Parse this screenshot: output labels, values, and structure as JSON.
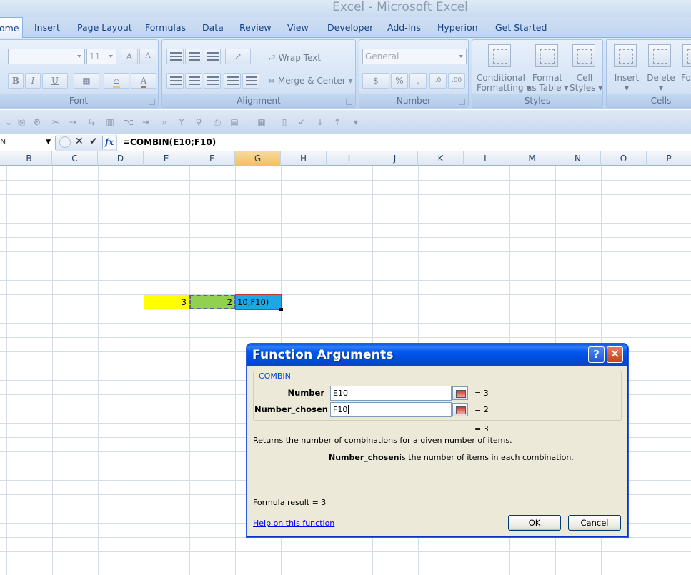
{
  "app": {
    "title": "Excel - Microsoft Excel"
  },
  "tabs": [
    {
      "label": "ome"
    },
    {
      "label": "Insert"
    },
    {
      "label": "Page Layout"
    },
    {
      "label": "Formulas"
    },
    {
      "label": "Data"
    },
    {
      "label": "Review"
    },
    {
      "label": "View"
    },
    {
      "label": "Developer"
    },
    {
      "label": "Add-Ins"
    },
    {
      "label": "Hyperion"
    },
    {
      "label": "Get Started"
    }
  ],
  "ribbon": {
    "font": {
      "label": "Font",
      "size": "11",
      "bold": "B",
      "italic": "I",
      "underline": "U"
    },
    "alignment": {
      "label": "Alignment",
      "wrap_text": "Wrap Text",
      "merge_center": "Merge & Center"
    },
    "number": {
      "label": "Number",
      "format": "General",
      "percent": "%",
      "comma": ","
    },
    "styles": {
      "label": "Styles",
      "conditional_1": "Conditional",
      "conditional_2": "Formatting",
      "format_table_1": "Format",
      "format_table_2": "as Table",
      "cell_styles_1": "Cell",
      "cell_styles_2": "Styles"
    },
    "cells": {
      "label": "Cells",
      "insert": "Insert",
      "delete": "Delete",
      "format_partial": "Fo"
    }
  },
  "formula_bar": {
    "name_box": "N",
    "formula": "=COMBIN(E10;F10)"
  },
  "columns": [
    "B",
    "C",
    "D",
    "E",
    "F",
    "G",
    "H",
    "I",
    "J",
    "K",
    "L",
    "M",
    "N",
    "O",
    "P"
  ],
  "selected_column": "G",
  "cells": {
    "e10": "3",
    "f10": "2",
    "g10": "10;F10)"
  },
  "colors": {
    "e10_fill": "#ffff00",
    "f10_fill": "#92d050",
    "g10_fill": "#1ea7e6"
  },
  "dialog": {
    "title": "Function Arguments",
    "help_glyph": "?",
    "close_glyph": "✕",
    "function_name": "COMBIN",
    "args": [
      {
        "label": "Number",
        "value": "E10",
        "result": "=  3"
      },
      {
        "label": "Number_chosen",
        "value": "F10",
        "result": "=  2"
      }
    ],
    "overall_result": "=  3",
    "description": "Returns the number of combinations for a given number of items.",
    "arg_help_name": "Number_chosen",
    "arg_help_text": "is the number of items in each combination.",
    "formula_result": "Formula result =   3",
    "help_link": "Help on this function",
    "ok": "OK",
    "cancel": "Cancel"
  }
}
